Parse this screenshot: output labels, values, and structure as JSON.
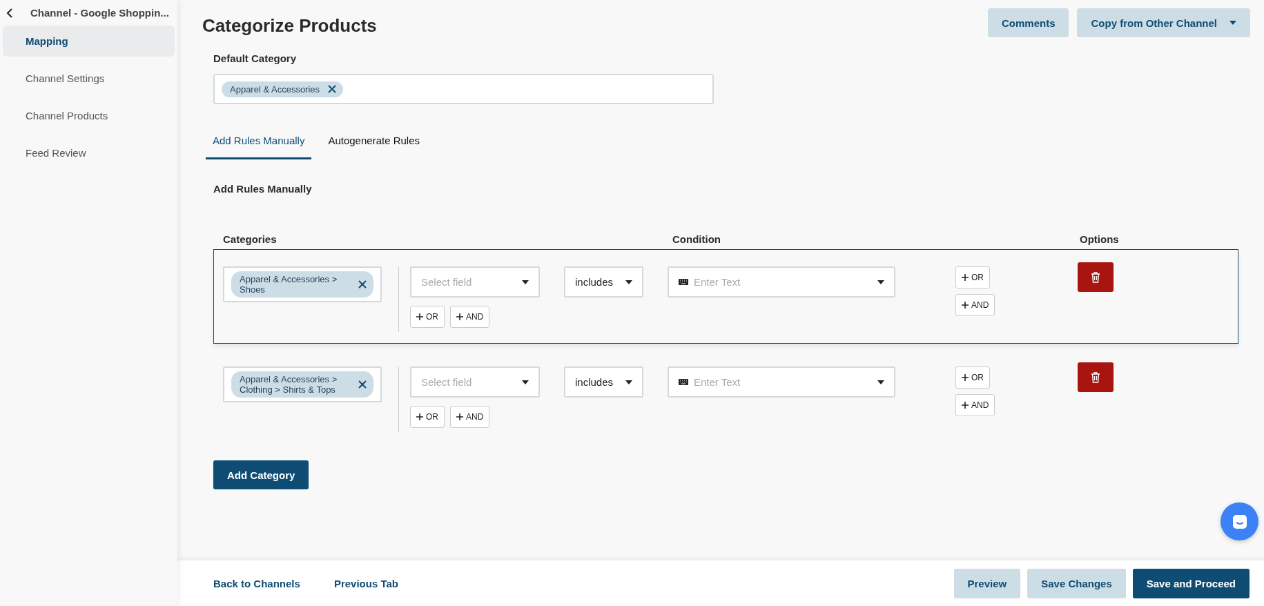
{
  "sidebar": {
    "back_title": "Channel - Google Shoppin...",
    "items": [
      {
        "label": "Mapping",
        "selected": true
      },
      {
        "label": "Channel Settings",
        "selected": false
      },
      {
        "label": "Channel Products",
        "selected": false
      },
      {
        "label": "Feed Review",
        "selected": false
      }
    ]
  },
  "page": {
    "title": "Categorize Products",
    "header_buttons": [
      {
        "label": "Comments",
        "kind": "plain"
      },
      {
        "label": "Copy from Other Channel",
        "kind": "dropdown"
      }
    ]
  },
  "default_category": {
    "label": "Default Category",
    "tags": [
      "Apparel & Accessories"
    ]
  },
  "tabs": [
    {
      "label": "Add Rules Manually",
      "selected": true
    },
    {
      "label": "Autogenerate Rules",
      "selected": false
    }
  ],
  "section_title": "Add Rules Manually",
  "rules_table": {
    "columns": [
      "Categories",
      "Condition",
      "Options"
    ],
    "rows": [
      {
        "selected": true,
        "category_tag": "Apparel & Accessories > Shoes",
        "field_placeholder": "Select field",
        "operator": "includes",
        "text_placeholder": "Enter Text",
        "options": [
          "OR",
          "AND"
        ],
        "condition_buttons": [
          "OR",
          "AND"
        ]
      },
      {
        "selected": false,
        "category_tag": "Apparel & Accessories > Clothing > Shirts & Tops",
        "field_placeholder": "Select field",
        "operator": "includes",
        "text_placeholder": "Enter Text",
        "options": [
          "OR",
          "AND"
        ],
        "condition_buttons": [
          "OR",
          "AND"
        ]
      }
    ]
  },
  "add_category_button": "Add Category",
  "footer": {
    "links": [
      "Back to Channels",
      "Previous Tab"
    ],
    "buttons": [
      {
        "label": "Preview",
        "kind": "secondary"
      },
      {
        "label": "Save Changes",
        "kind": "secondary"
      },
      {
        "label": "Save and Proceed",
        "kind": "primary"
      }
    ]
  }
}
